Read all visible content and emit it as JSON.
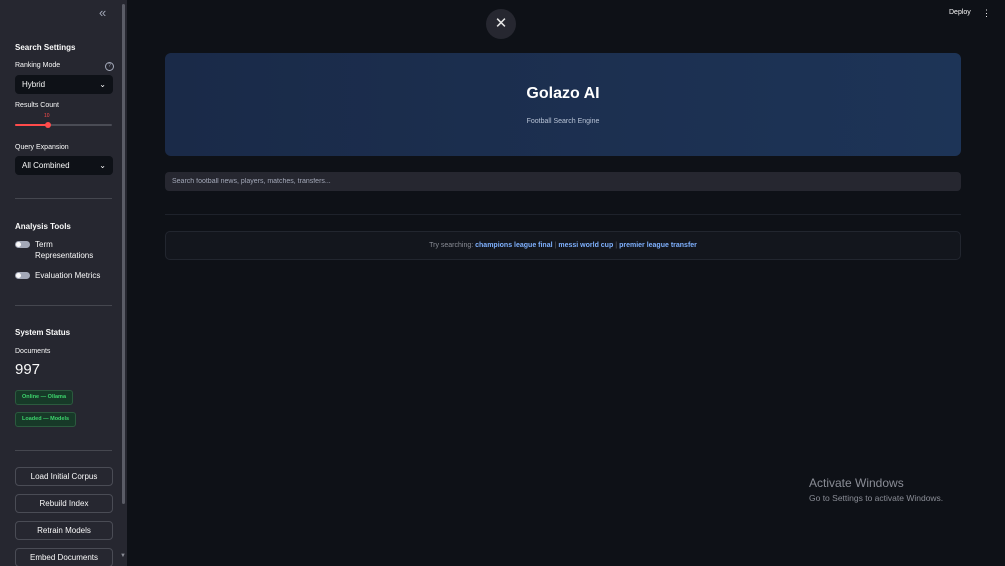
{
  "sidebar": {
    "collapse_icon": "double-chevron-left-icon",
    "search_settings": {
      "heading": "Search Settings",
      "ranking_mode_label": "Ranking Mode",
      "ranking_mode_value": "Hybrid",
      "results_count_label": "Results Count",
      "results_count_value": "10",
      "query_expansion_label": "Query Expansion",
      "query_expansion_value": "All Combined"
    },
    "analysis_tools": {
      "heading": "Analysis Tools",
      "toggles": [
        {
          "label": "Term Representations",
          "on": false
        },
        {
          "label": "Evaluation Metrics",
          "on": false
        }
      ]
    },
    "system_status": {
      "heading": "System Status",
      "documents_label": "Documents",
      "documents_value": "997",
      "badges": [
        "Online — Ollama",
        "Loaded — Models"
      ]
    },
    "buttons": [
      "Load Initial Corpus",
      "Rebuild Index",
      "Retrain Models",
      "Embed Documents"
    ]
  },
  "header": {
    "deploy_label": "Deploy",
    "close_glyph": "✕"
  },
  "hero": {
    "title": "Golazo AI",
    "subtitle": "Football Search Engine"
  },
  "search": {
    "placeholder": "Search football news, players, matches, transfers...",
    "value": ""
  },
  "suggestions": {
    "prefix": "Try searching:",
    "items": [
      "champions league final",
      "messi world cup",
      "premier league transfer"
    ]
  },
  "windows_watermark": {
    "title": "Activate Windows",
    "subtitle": "Go to Settings to activate Windows."
  },
  "colors": {
    "background": "#0e1117",
    "sidebar": "#262730",
    "accent": "#ff4b4b",
    "hero": "#1d3457",
    "link": "#7fb1ff",
    "success": "#3dd56d"
  }
}
